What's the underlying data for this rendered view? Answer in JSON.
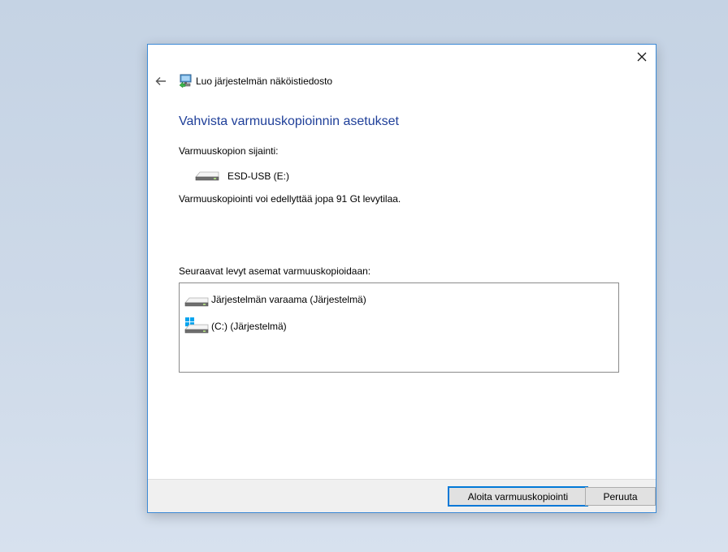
{
  "window": {
    "title": "Luo järjestelmän näköistiedosto"
  },
  "page": {
    "heading": "Vahvista varmuuskopioinnin asetukset",
    "location_label": "Varmuuskopion sijainti:",
    "destination": {
      "label": "ESD-USB (E:)",
      "icon": "drive-icon"
    },
    "space_note": "Varmuuskopiointi voi edellyttää jopa 91 Gt levytilaa.",
    "drives_label": "Seuraavat levyt asemat varmuuskopioidaan:",
    "drives": [
      {
        "label": "Järjestelmän varaama (Järjestelmä)",
        "icon": "drive-icon"
      },
      {
        "label": "(C:) (Järjestelmä)",
        "icon": "windows-drive-icon"
      }
    ]
  },
  "buttons": {
    "start": "Aloita varmuuskopiointi",
    "cancel": "Peruuta"
  },
  "colors": {
    "heading": "#1f3f99",
    "accent": "#0078d7",
    "windows_logo": "#00a4ef"
  }
}
